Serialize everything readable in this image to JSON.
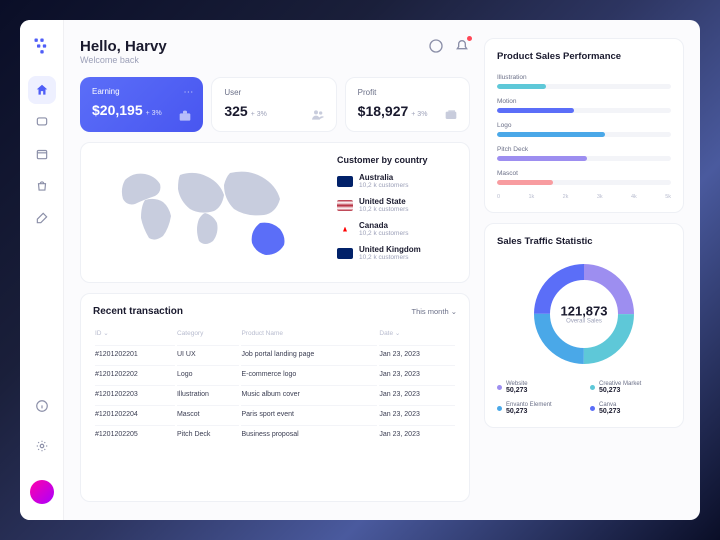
{
  "greeting": {
    "title": "Hello, Harvy",
    "subtitle": "Welcome back"
  },
  "stats": {
    "earning": {
      "label": "Earning",
      "value": "$20,195",
      "change": "+ 3%"
    },
    "user": {
      "label": "User",
      "value": "325",
      "change": "+ 3%"
    },
    "profit": {
      "label": "Profit",
      "value": "$18,927",
      "change": "+ 3%"
    }
  },
  "countries": {
    "title": "Customer by country",
    "items": [
      {
        "name": "Australia",
        "sub": "10,2 k customers",
        "flag": "au"
      },
      {
        "name": "United State",
        "sub": "10,2 k customers",
        "flag": "us"
      },
      {
        "name": "Canada",
        "sub": "10,2 k customers",
        "flag": "ca"
      },
      {
        "name": "United Kingdom",
        "sub": "10,2 k customers",
        "flag": "uk"
      }
    ]
  },
  "transactions": {
    "title": "Recent transaction",
    "filter": "This month",
    "headers": {
      "id": "ID",
      "category": "Category",
      "product": "Product Name",
      "date": "Date"
    },
    "rows": [
      {
        "id": "#1201202201",
        "cat": "UI UX",
        "prod": "Job portal landing page",
        "date": "Jan 23, 2023"
      },
      {
        "id": "#1201202202",
        "cat": "Logo",
        "prod": "E-commerce logo",
        "date": "Jan 23, 2023"
      },
      {
        "id": "#1201202203",
        "cat": "Illustration",
        "prod": "Music album cover",
        "date": "Jan 23, 2023"
      },
      {
        "id": "#1201202204",
        "cat": "Mascot",
        "prod": "Paris sport event",
        "date": "Jan 23, 2023"
      },
      {
        "id": "#1201202205",
        "cat": "Pitch Deck",
        "prod": "Business proposal",
        "date": "Jan 23, 2023"
      }
    ]
  },
  "chart_data": {
    "bars": {
      "title": "Product Sales Performance",
      "type": "bar",
      "xlim": [
        0,
        5000
      ],
      "ticks": [
        "0",
        "1k",
        "2k",
        "3k",
        "4k",
        "5k"
      ],
      "items": [
        {
          "label": "Illustration",
          "value": 1400,
          "color": "#5ec8d8"
        },
        {
          "label": "Motion",
          "value": 2200,
          "color": "#5b6ef8"
        },
        {
          "label": "Logo",
          "value": 3100,
          "color": "#4aa8e8"
        },
        {
          "label": "Pitch Deck",
          "value": 2600,
          "color": "#9d8ef0"
        },
        {
          "label": "Mascot",
          "value": 1600,
          "color": "#f89ca0"
        }
      ]
    },
    "donut": {
      "title": "Sales Traffic Statistic",
      "type": "pie",
      "center_value": "121,873",
      "center_label": "Overall Sales",
      "series": [
        {
          "name": "Website",
          "value": 50273,
          "color": "#9d8ef0",
          "pct": 25
        },
        {
          "name": "Creative Market",
          "value": 50273,
          "color": "#5ec8d8",
          "pct": 25
        },
        {
          "name": "Envanto Element",
          "value": 50273,
          "color": "#4aa8e8",
          "pct": 25
        },
        {
          "name": "Canva",
          "value": 50273,
          "color": "#5b6ef8",
          "pct": 25
        }
      ]
    }
  }
}
